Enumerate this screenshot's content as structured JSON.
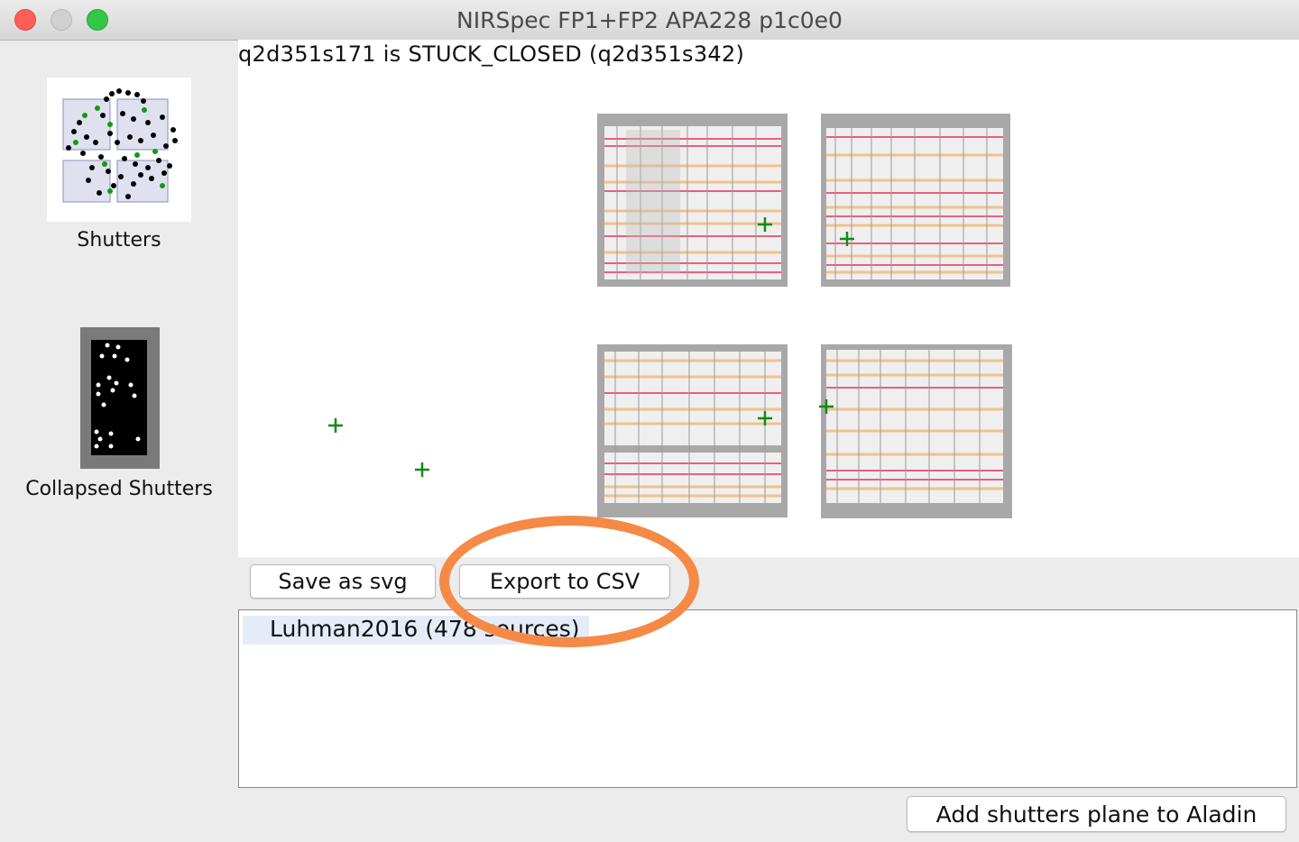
{
  "window": {
    "title": "NIRSpec FP1+FP2 APA228 p1c0e0",
    "controls": [
      "close-button",
      "minimize-button",
      "zoom-button"
    ]
  },
  "sidebar": {
    "items": [
      {
        "label": "Shutters"
      },
      {
        "label": "Collapsed Shutters"
      }
    ]
  },
  "canvas": {
    "status_text": "q2d351s171 is STUCK_CLOSED (q2d351s342)",
    "quadrants": 4,
    "colors": {
      "stuck_open_rows": "#e8607a",
      "stuck_closed_rows": "#f0c28e",
      "marker": "#138a13"
    }
  },
  "toolbar": {
    "save_svg_label": "Save as svg",
    "export_csv_label": "Export to CSV"
  },
  "catalog_list": {
    "items": [
      {
        "label": "Luhman2016 (478 sources)"
      }
    ]
  },
  "footer": {
    "add_plane_label": "Add shutters plane to Aladin"
  },
  "annotation": {
    "highlight_color": "#f58a46"
  }
}
